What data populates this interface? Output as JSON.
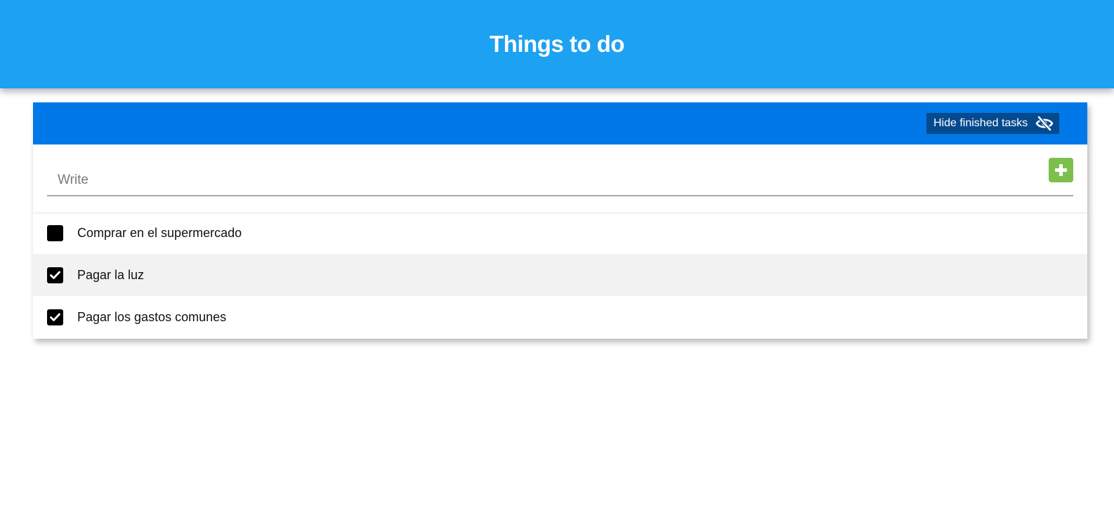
{
  "header": {
    "title": "Things to do"
  },
  "toolbar": {
    "hide_finished_label": "Hide finished tasks",
    "hide_icon": "eye-slash-icon"
  },
  "new_task": {
    "placeholder": "Write",
    "value": "",
    "add_icon": "plus-icon"
  },
  "tasks": [
    {
      "text": "Comprar en el supermercado",
      "done": false
    },
    {
      "text": "Pagar la luz",
      "done": true
    },
    {
      "text": "Pagar los gastos comunes",
      "done": true
    }
  ],
  "colors": {
    "header_bg": "#1da1f2",
    "toolbar_bg": "#0078e8",
    "hide_button_bg": "#054a8e",
    "add_button_bg": "#7cc04b",
    "alt_row_bg": "#f2f2f2"
  }
}
